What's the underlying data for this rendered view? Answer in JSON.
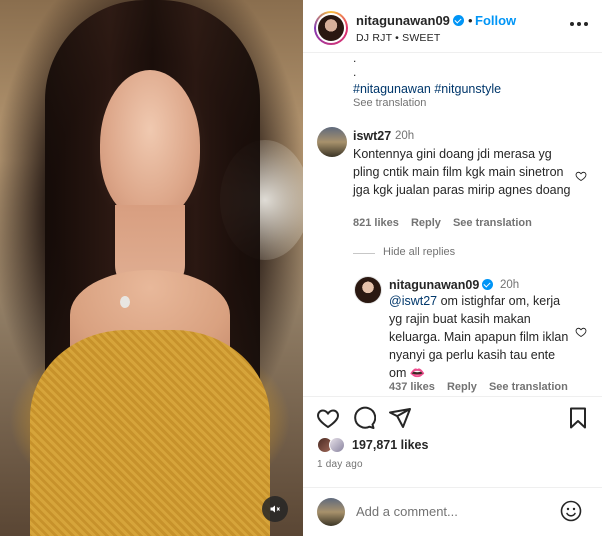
{
  "media": {
    "mute_icon": "muted-speaker-icon"
  },
  "header": {
    "username": "nitagunawan09",
    "dot": "•",
    "follow_label": "Follow",
    "music": "DJ RJT • SWEET",
    "more_icon": "more-options-icon"
  },
  "caption": {
    "dots": [
      ".",
      "."
    ],
    "hashtags": [
      "#nitagunawan",
      "#nitgunstyle"
    ],
    "see_translation": "See translation"
  },
  "comment": {
    "username": "iswt27",
    "time": "20h",
    "text": "Kontennya gini doang jdi merasa yg pling cntik main film kgk main sinetron jga kgk jualan paras mirip agnes doang",
    "likes": "821 likes",
    "reply": "Reply",
    "see_translation": "See translation",
    "hide_replies": "Hide all replies"
  },
  "reply": {
    "username": "nitagunawan09",
    "time": "20h",
    "mention": "@iswt27",
    "text": " om istighfar om, kerja yg rajin buat kasih makan keluarga. Main apapun film iklan nyanyi ga perlu kasih tau ente om",
    "emoji": "👄",
    "likes": "437 likes",
    "reply": "Reply",
    "see_translation": "See translation"
  },
  "actions": {
    "like_icon": "heart-icon",
    "comment_icon": "comment-icon",
    "share_icon": "share-icon",
    "save_icon": "bookmark-icon"
  },
  "likes": {
    "count": "197,871 likes"
  },
  "date": "1 day ago",
  "add_comment": {
    "placeholder": "Add a comment...",
    "emoji_icon": "smiley-icon"
  },
  "colors": {
    "link_blue": "#0095f6",
    "hashtag": "#00376b",
    "muted_text": "#737373"
  }
}
